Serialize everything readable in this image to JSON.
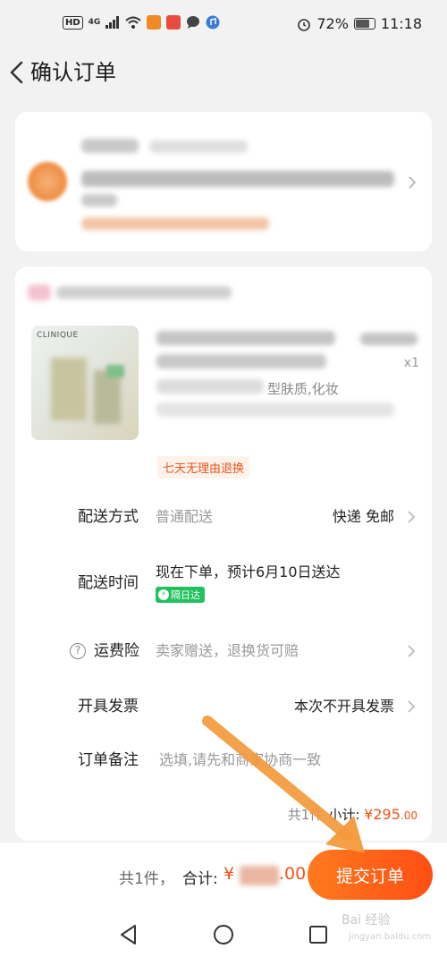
{
  "status_bar": {
    "hd": "HD",
    "network": "4G",
    "battery": "72%",
    "time": "11:18"
  },
  "header": {
    "title": "确认订单"
  },
  "product": {
    "brand_text": "CLINIQUE",
    "suffix": "型肤质,化妆",
    "qty": "x1",
    "return_tag": "七天无理由退换"
  },
  "rows": {
    "delivery_method": {
      "label": "配送方式",
      "value": "普通配送",
      "right": "快递 免邮"
    },
    "delivery_time": {
      "label": "配送时间",
      "value": "现在下单，预计6月10日送达",
      "badge": "隔日达"
    },
    "shipping_insurance": {
      "label": "运费险",
      "value": "卖家赠送，退换货可赔"
    },
    "invoice": {
      "label": "开具发票",
      "right": "本次不开具发票"
    },
    "note": {
      "label": "订单备注",
      "placeholder": "选填,请先和商家协商一致"
    }
  },
  "subtotal": {
    "prefix": "共1件",
    "label": "小计:",
    "currency": "¥",
    "amount": "295",
    "cents": ".00"
  },
  "bottom_bar": {
    "count": "共1件，",
    "total_label": "合计:",
    "total_currency": "¥",
    "total_tail": ".00",
    "submit_label": "提交订单"
  },
  "watermark": {
    "text": "Bai 经验",
    "sub": "jingyan.baidu.com"
  },
  "colors": {
    "accent": "#f0531b",
    "button_gradient_start": "#ff7a1e",
    "button_gradient_end": "#ff4e14",
    "badge_green": "#22c15e",
    "annotation_arrow": "#f39a3b"
  }
}
